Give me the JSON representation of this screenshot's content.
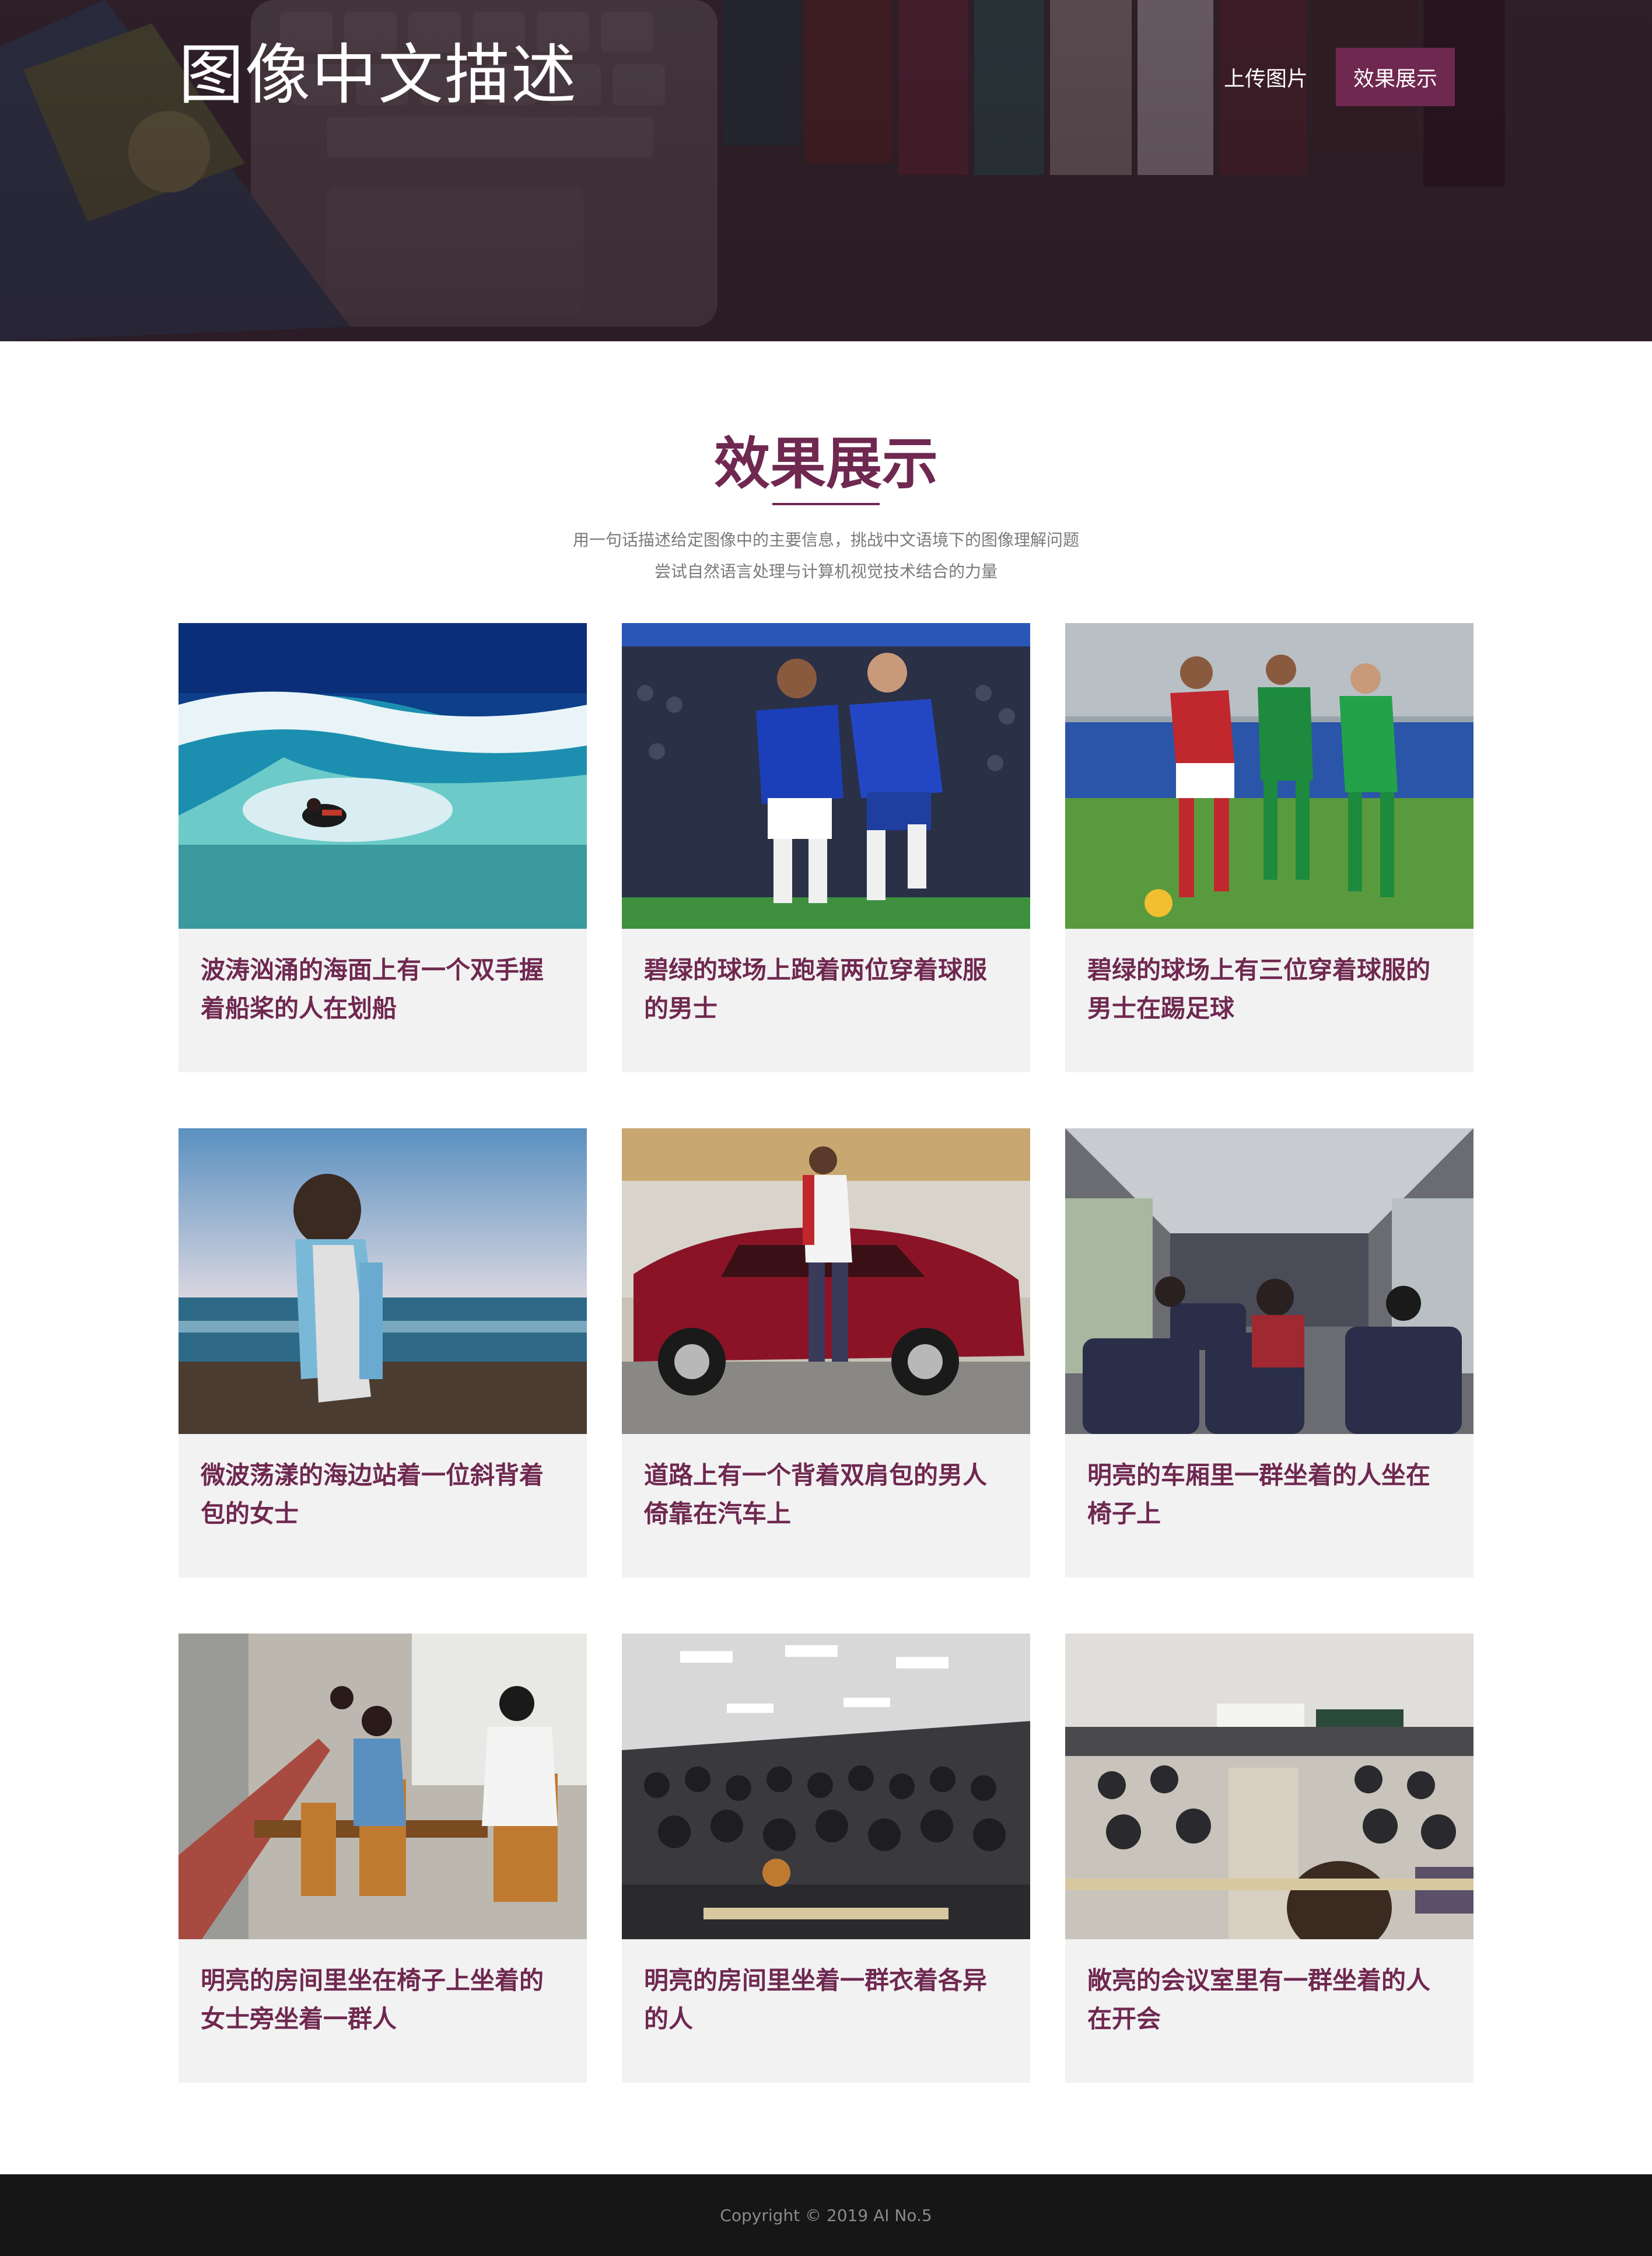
{
  "header": {
    "site_title": "图像中文描述",
    "nav": [
      {
        "label": "上传图片",
        "active": false
      },
      {
        "label": "效果展示",
        "active": true
      }
    ]
  },
  "section": {
    "title": "效果展示",
    "intro_lines": [
      "用一句话描述给定图像中的主要信息，挑战中文语境下的图像理解问题",
      "尝试自然语言处理与计算机视觉技术结合的力量"
    ]
  },
  "gallery": {
    "items": [
      {
        "caption": "波涛汹涌的海面上有一个双手握着船桨的人在划船"
      },
      {
        "caption": "碧绿的球场上跑着两位穿着球服的男士"
      },
      {
        "caption": "碧绿的球场上有三位穿着球服的男士在踢足球"
      },
      {
        "caption": "微波荡漾的海边站着一位斜背着包的女士"
      },
      {
        "caption": "道路上有一个背着双肩包的男人倚靠在汽车上"
      },
      {
        "caption": "明亮的车厢里一群坐着的人坐在椅子上"
      },
      {
        "caption": "明亮的房间里坐在椅子上坐着的女士旁坐着一群人"
      },
      {
        "caption": "明亮的房间里坐着一群衣着各异的人"
      },
      {
        "caption": "敞亮的会议室里有一群坐着的人在开会"
      }
    ]
  },
  "footer": {
    "copyright": "Copyright © 2019 AI No.5"
  },
  "colors": {
    "accent": "#6f2850",
    "card_background": "#f2f2f2",
    "footer_background": "#161616",
    "intro_text": "#7a7a7a"
  }
}
